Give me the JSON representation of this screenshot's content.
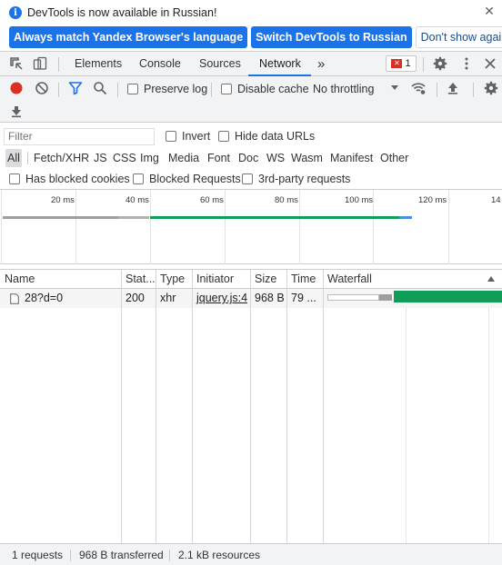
{
  "infobar": {
    "message": "DevTools is now available in Russian!",
    "btn_match": "Always match Yandex Browser's language",
    "btn_switch": "Switch DevTools to Russian",
    "btn_dont_show": "Don't show again"
  },
  "tabs": {
    "elements": "Elements",
    "console": "Console",
    "sources": "Sources",
    "network": "Network",
    "more": "»",
    "error_count": "1"
  },
  "toolbar": {
    "preserve_log": "Preserve log",
    "disable_cache": "Disable cache",
    "throttling": "No throttling"
  },
  "filter": {
    "placeholder": "Filter",
    "invert": "Invert",
    "hide_data_urls": "Hide data URLs",
    "types": [
      "All",
      "Fetch/XHR",
      "JS",
      "CSS",
      "Img",
      "Media",
      "Font",
      "Doc",
      "WS",
      "Wasm",
      "Manifest",
      "Other"
    ],
    "has_blocked_cookies": "Has blocked cookies",
    "blocked_requests": "Blocked Requests",
    "third_party": "3rd-party requests"
  },
  "overview": {
    "ticks": [
      "20 ms",
      "40 ms",
      "60 ms",
      "80 ms",
      "100 ms",
      "120 ms",
      "14"
    ]
  },
  "table": {
    "headers": {
      "name": "Name",
      "status": "Stat...",
      "type": "Type",
      "initiator": "Initiator",
      "size": "Size",
      "time": "Time",
      "waterfall": "Waterfall"
    },
    "rows": [
      {
        "name": "28?d=0",
        "status": "200",
        "type": "xhr",
        "initiator": "jquery.js:4",
        "size": "968 B",
        "time": "79 ..."
      }
    ]
  },
  "status": {
    "requests": "1 requests",
    "transferred": "968 B transferred",
    "resources": "2.1 kB resources"
  },
  "colors": {
    "accent": "#1a73e8",
    "record_red": "#d93025",
    "waterfall_green": "#0f9d58",
    "waterfall_gray": "#9e9e9e"
  }
}
